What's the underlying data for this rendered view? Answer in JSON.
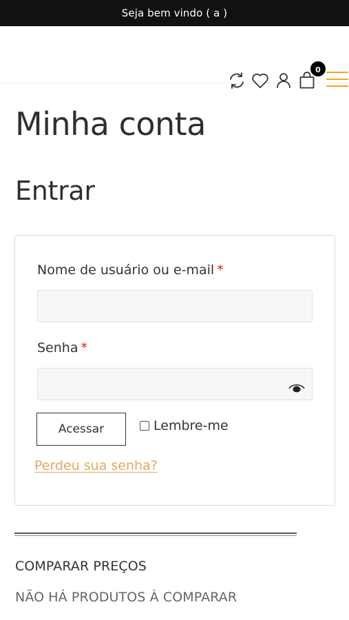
{
  "topbar": {
    "welcome_text": "Seja bem vindo ( a )"
  },
  "header": {
    "icons": [
      "refresh-compare-icon",
      "heart-wishlist-icon",
      "user-account-icon",
      "shopping-bag-icon",
      "hamburger-menu-icon"
    ],
    "cart_count": "0",
    "accent_color": "#f3a51c"
  },
  "page": {
    "title": "Minha conta"
  },
  "login": {
    "heading": "Entrar",
    "username_label": "Nome de usuário ou e-mail",
    "password_label": "Senha",
    "required_mark": "*",
    "username_value": "",
    "password_value": "",
    "submit_label": "Acessar",
    "remember_label": "Lembre-me",
    "remember_checked": false,
    "lost_password_link": "Perdeu sua senha?",
    "link_color": "#e3a85e",
    "required_color": "#e31b1b"
  },
  "compare": {
    "heading": "COMPARAR PREÇOS",
    "empty_text": "NÃO HÁ PRODUTOS À COMPARAR"
  }
}
